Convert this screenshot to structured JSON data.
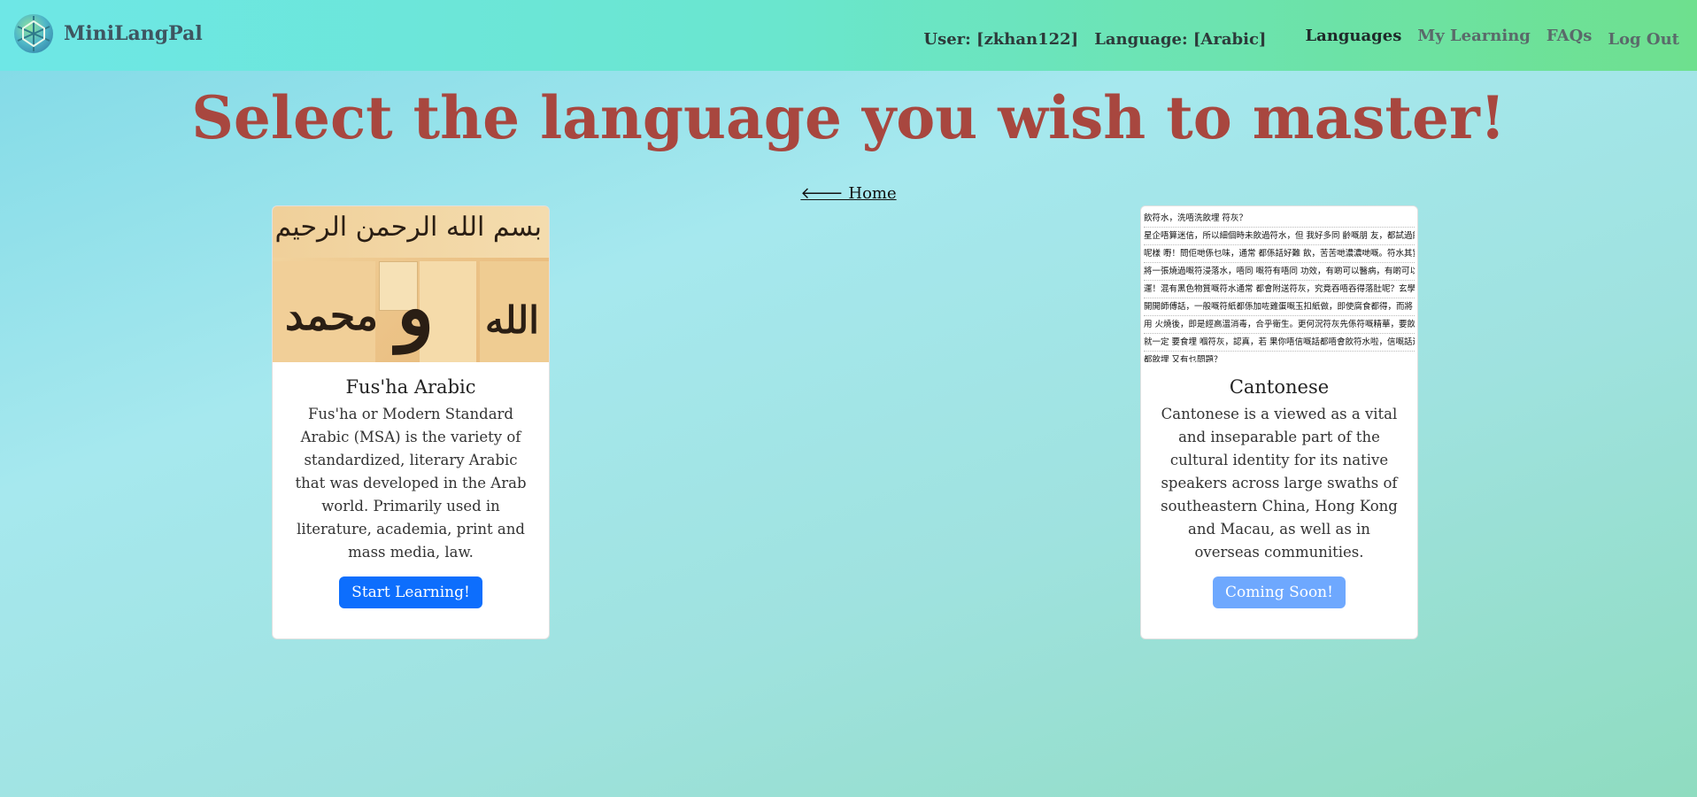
{
  "brand": {
    "name": "MiniLangPal"
  },
  "nav": {
    "user": "User: [zkhan122]",
    "language": "Language: [Arabic]",
    "links": [
      "Languages",
      "My Learning",
      "FAQs"
    ],
    "logout": "Log Out"
  },
  "page": {
    "title": "Select the language you wish to master!",
    "home": "🡐 Home"
  },
  "cards": [
    {
      "title": "Fus'ha Arabic",
      "description": "Fus'ha or Modern Standard Arabic (MSA) is the variety of standardized, literary Arabic that was developed in the Arab world. Primarily used in literature, academia, print and mass media, law.",
      "button": "Start Learning!",
      "image_text": [
        "بسم الله الرحمن الرحيم",
        "محمد",
        "و",
        "الله"
      ]
    },
    {
      "title": "Cantonese",
      "description": "Cantonese is a viewed as a vital and inseparable part of the cultural identity for its native speakers across large swaths of southeastern China, Hong Kong and Macau, as well as in overseas communities.",
      "button": "Coming Soon!",
      "image_text": [
        "飲符水，洗唔洗飲埋 符灰？",
        "星企唔算迷信，所以細個時未飲過符水，但 我好多同 齡嘅朋 友，都試過飲符水",
        "呢樣 嘢！問佢哋係乜味，通常 都係話好難 飲，苦苦哋濃濃哋嘅。符水其實係",
        "將一張燒過嘅符浸落水，唔同 嘅符有唔同 功效，有啲可以醫病，有啲可以改",
        "運！混有黑色物質嘅符水通常 都會附送符灰，究竟吞唔吞得落肚呢？玄學家方",
        "開開師傅話，一般嘅符紙都係加咗雞蛋嘅玉扣紙做，即使腐食都得，而將 道符",
        "用 火燒後，即是經高溫消毒，合乎衛生。更何況符灰先係符嘅精華，要飲符水",
        "就一定 要食埋 嗰符灰，認真，若 果你唔信嘅話都唔會飲符水啦，信嘅話連符灰",
        "都飲埋 又有乜問題？"
      ]
    }
  ],
  "colors": {
    "title": "#a8473f",
    "primary_button": "#0d6efd",
    "disabled_button": "#6ea8fe"
  }
}
